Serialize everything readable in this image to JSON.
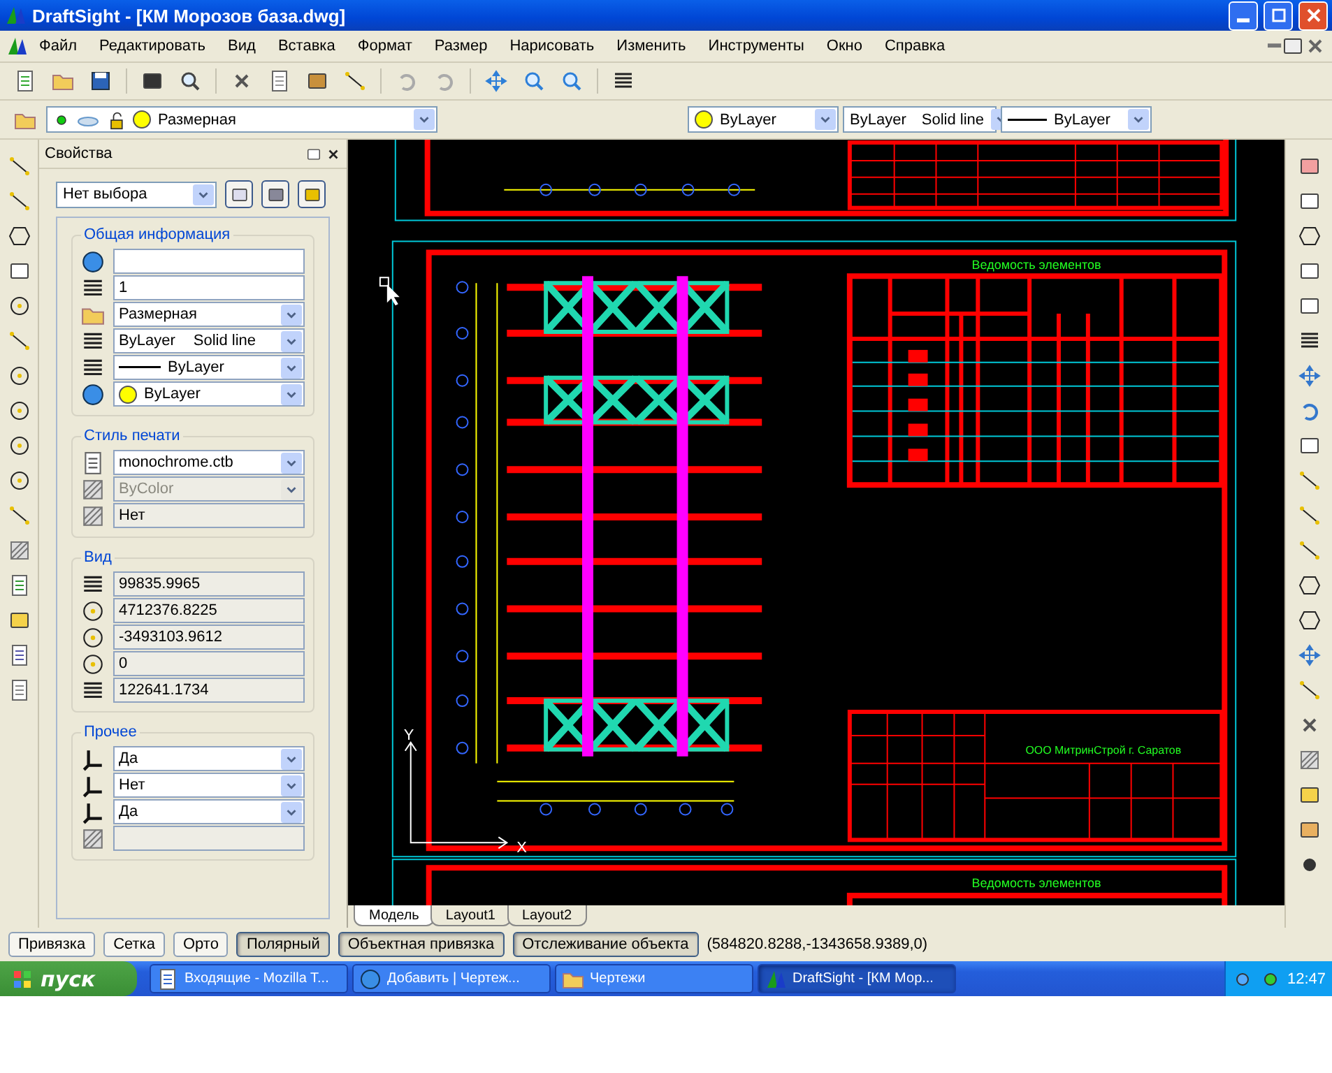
{
  "window": {
    "title": "DraftSight - [КМ Морозов база.dwg]"
  },
  "menu": [
    "Файл",
    "Редактировать",
    "Вид",
    "Вставка",
    "Формат",
    "Размер",
    "Нарисовать",
    "Изменить",
    "Инструменты",
    "Окно",
    "Справка"
  ],
  "layer_toolbar": {
    "layer": "Размерная",
    "color_name": "ByLayer",
    "color": "#ffff00",
    "linetype": "ByLayer",
    "linetype_style": "Solid line",
    "lineweight": "ByLayer"
  },
  "properties": {
    "title": "Свойства",
    "selection": "Нет выбора",
    "sections": [
      {
        "title": "Общая информация",
        "rows": [
          {
            "kind": "text",
            "readonly": false
          },
          {
            "kind": "text",
            "value": "1",
            "readonly": false
          },
          {
            "kind": "select",
            "value": "Размерная",
            "readonly": false
          },
          {
            "kind": "linetype",
            "value": "ByLayer",
            "style": "Solid line",
            "readonly": false
          },
          {
            "kind": "lineweight",
            "value": "ByLayer",
            "readonly": false
          },
          {
            "kind": "select",
            "value": "ByLayer",
            "color": "#ffff00",
            "readonly": false
          }
        ]
      },
      {
        "title": "Стиль печати",
        "rows": [
          {
            "kind": "select",
            "value": "monochrome.ctb",
            "readonly": false
          },
          {
            "kind": "select",
            "value": "ByColor",
            "readonly": true
          },
          {
            "kind": "text",
            "value": "Нет",
            "readonly": true
          }
        ]
      },
      {
        "title": "Вид",
        "rows": [
          {
            "kind": "text",
            "value": "99835.9965",
            "readonly": true
          },
          {
            "kind": "text",
            "value": "4712376.8225",
            "readonly": true
          },
          {
            "kind": "text",
            "value": "-3493103.9612",
            "readonly": true
          },
          {
            "kind": "text",
            "value": "0",
            "readonly": true
          },
          {
            "kind": "text",
            "value": "122641.1734",
            "readonly": true
          }
        ]
      },
      {
        "title": "Прочее",
        "rows": [
          {
            "kind": "select",
            "value": "Да",
            "readonly": false
          },
          {
            "kind": "select",
            "value": "Нет",
            "readonly": false
          },
          {
            "kind": "select",
            "value": "Да",
            "readonly": false
          },
          {
            "kind": "text",
            "readonly": true
          }
        ]
      }
    ]
  },
  "drawing": {
    "headings": [
      "Ведомость элементов",
      "Ведомость элементов"
    ],
    "company": "ООО МитринСтрой г. Саратов",
    "ucs_x": "X",
    "ucs_y": "Y"
  },
  "tabs": [
    {
      "label": "Модель",
      "selected": true
    },
    {
      "label": "Layout1",
      "selected": false
    },
    {
      "label": "Layout2",
      "selected": false
    }
  ],
  "status_buttons": [
    {
      "label": "Привязка",
      "on": false
    },
    {
      "label": "Сетка",
      "on": false
    },
    {
      "label": "Орто",
      "on": false
    },
    {
      "label": "Полярный",
      "on": true
    },
    {
      "label": "Объектная привязка",
      "on": true
    },
    {
      "label": "Отслеживание объекта",
      "on": true
    }
  ],
  "coordinates": "(584820.8288,-1343658.9389,0)",
  "taskbar": {
    "start": "пуск",
    "items": [
      {
        "label": "Входящие - Mozilla T...",
        "selected": false
      },
      {
        "label": "Добавить | Чертеж...",
        "selected": false
      },
      {
        "label": "Чертежи",
        "selected": false
      },
      {
        "label": "DraftSight - [КМ Мор...",
        "selected": true
      }
    ],
    "clock": "12:47"
  }
}
